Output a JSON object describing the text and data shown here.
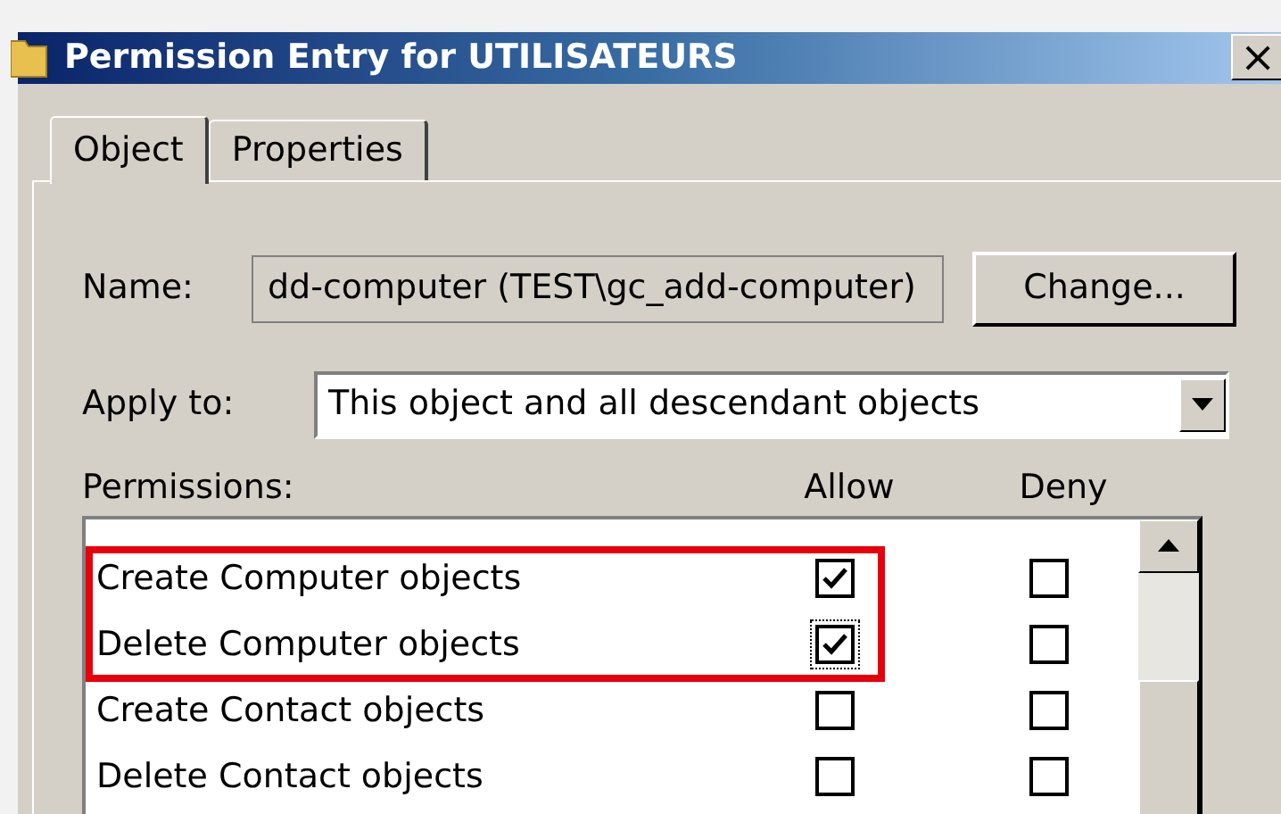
{
  "window": {
    "title": "Permission Entry for UTILISATEURS",
    "close": "×"
  },
  "tabs": [
    {
      "label": "Object",
      "selected": true
    },
    {
      "label": "Properties",
      "selected": false
    }
  ],
  "name": {
    "label": "Name:",
    "value": "dd-computer (TEST\\gc_add-computer)",
    "button": "Change..."
  },
  "apply_to": {
    "label": "Apply to:",
    "value": "This object and all descendant objects"
  },
  "permissions": {
    "label": "Permissions:",
    "columns": [
      "Allow",
      "Deny"
    ],
    "rows": [
      {
        "label": "Create Computer objects",
        "allow": true,
        "deny": false,
        "highlighted": true,
        "focused": false
      },
      {
        "label": "Delete Computer objects",
        "allow": true,
        "deny": false,
        "highlighted": true,
        "focused": true
      },
      {
        "label": "Create Contact objects",
        "allow": false,
        "deny": false,
        "highlighted": false,
        "focused": false
      },
      {
        "label": "Delete Contact objects",
        "allow": false,
        "deny": false,
        "highlighted": false,
        "focused": false
      }
    ]
  }
}
